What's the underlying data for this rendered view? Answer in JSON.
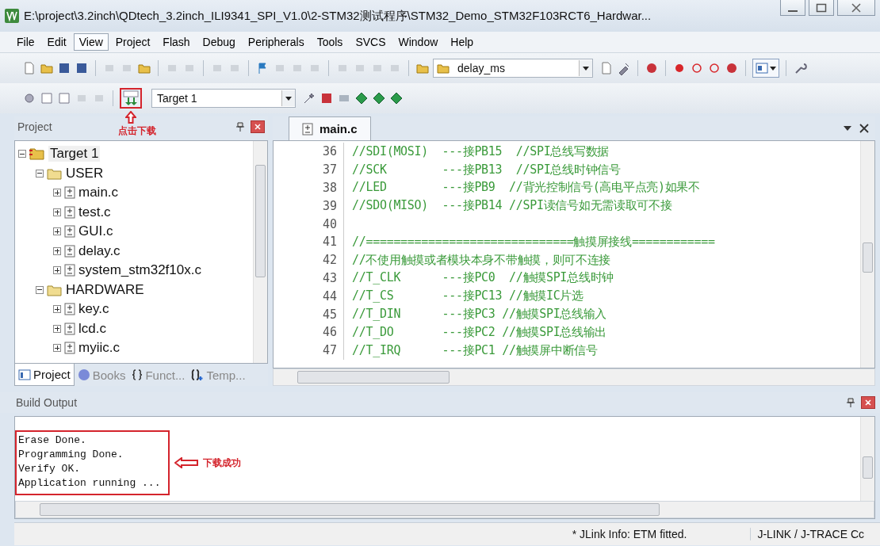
{
  "window": {
    "title": "E:\\project\\3.2inch\\QDtech_3.2inch_ILI9341_SPI_V1.0\\2-STM32测试程序\\STM32_Demo_STM32F103RCT6_Hardwar..."
  },
  "menu": [
    {
      "label": "File",
      "selected": false
    },
    {
      "label": "Edit",
      "selected": false
    },
    {
      "label": "View",
      "selected": true
    },
    {
      "label": "Project",
      "selected": false
    },
    {
      "label": "Flash",
      "selected": false
    },
    {
      "label": "Debug",
      "selected": false
    },
    {
      "label": "Peripherals",
      "selected": false
    },
    {
      "label": "Tools",
      "selected": false
    },
    {
      "label": "SVCS",
      "selected": false
    },
    {
      "label": "Window",
      "selected": false
    },
    {
      "label": "Help",
      "selected": false
    }
  ],
  "toolbar": {
    "find_combo": "delay_ms",
    "target_combo": "Target 1"
  },
  "project_panel": {
    "title": "Project",
    "tree": [
      {
        "label": "Target 1",
        "kind": "target",
        "expanded": true,
        "selected": true,
        "children": [
          {
            "label": "USER",
            "kind": "group",
            "expanded": true,
            "selected": false,
            "children": [
              {
                "label": "main.c",
                "kind": "file",
                "expanded": false,
                "selected": false
              },
              {
                "label": "test.c",
                "kind": "file",
                "expanded": false,
                "selected": false
              },
              {
                "label": "GUI.c",
                "kind": "file",
                "expanded": false,
                "selected": false
              },
              {
                "label": "delay.c",
                "kind": "file",
                "expanded": false,
                "selected": false
              },
              {
                "label": "system_stm32f10x.c",
                "kind": "file",
                "expanded": false,
                "selected": false
              }
            ]
          },
          {
            "label": "HARDWARE",
            "kind": "group",
            "expanded": true,
            "selected": false,
            "children": [
              {
                "label": "key.c",
                "kind": "file",
                "expanded": false,
                "selected": false
              },
              {
                "label": "lcd.c",
                "kind": "file",
                "expanded": false,
                "selected": false
              },
              {
                "label": "myiic.c",
                "kind": "file",
                "expanded": false,
                "selected": false
              }
            ]
          }
        ]
      }
    ],
    "tabs": [
      {
        "label": "Project",
        "selected": true
      },
      {
        "label": "Books",
        "selected": false
      },
      {
        "label": "Funct...",
        "selected": false
      },
      {
        "label": "Temp...",
        "selected": false
      }
    ]
  },
  "editor": {
    "tabs": [
      {
        "label": "main.c",
        "selected": true
      }
    ],
    "lines": [
      {
        "number": "36",
        "text": "//SDI(MOSI)  ---接PB15  //SPI总线写数据"
      },
      {
        "number": "37",
        "text": "//SCK        ---接PB13  //SPI总线时钟信号"
      },
      {
        "number": "38",
        "text": "//LED        ---接PB9  //背光控制信号(高电平点亮)如果不"
      },
      {
        "number": "39",
        "text": "//SDO(MISO)  ---接PB14 //SPI读信号如无需读取可不接"
      },
      {
        "number": "40"
      },
      {
        "number": "41",
        "text": "//==============================触摸屏接线============"
      },
      {
        "number": "42",
        "text": "//不使用触摸或者模块本身不带触摸，则可不连接"
      },
      {
        "number": "43",
        "text": "//T_CLK      ---接PC0  //触摸SPI总线时钟"
      },
      {
        "number": "44",
        "text": "//T_CS       ---接PC13 //触摸IC片选"
      },
      {
        "number": "45",
        "text": "//T_DIN      ---接PC3 //触摸SPI总线输入"
      },
      {
        "number": "46",
        "text": "//T_DO       ---接PC2 //触摸SPI总线输出"
      },
      {
        "number": "47",
        "text": "//T_IRQ      ---接PC1 //触摸屏中断信号"
      }
    ]
  },
  "build_output": {
    "title": "Build Output",
    "lines": [
      "Erase Done.",
      "Programming Done.",
      "Verify OK.",
      "Application running ..."
    ]
  },
  "annotations": [
    {
      "text": "点击下载"
    },
    {
      "text": "下载成功"
    }
  ],
  "status_bar": {
    "message": "* JLink Info: ETM fitted.",
    "debugger": "J-LINK / J-TRACE Cc"
  }
}
